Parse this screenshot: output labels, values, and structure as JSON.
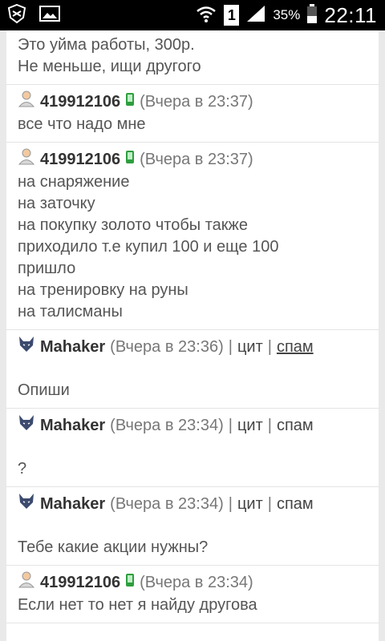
{
  "status_bar": {
    "battery_percent": "35%",
    "clock": "22:11",
    "sim_label": "1",
    "icons": [
      "shield-icon",
      "image-icon",
      "wifi-icon",
      "sim-icon",
      "signal-icon",
      "battery-icon"
    ]
  },
  "messages": [
    {
      "kind": "continuation",
      "lines": [
        "Это уйма работы, 300р.",
        "Не меньше, ищи другого"
      ]
    },
    {
      "author": "419912106",
      "time": "(Вчера в 23:37)",
      "lines": [
        "все что надо мне"
      ]
    },
    {
      "author": "419912106",
      "time": "(Вчера в 23:37)",
      "lines": [
        "на снаряжение",
        "на заточку",
        "на покупку золото чтобы также",
        "приходило т.е купил 100 и еще 100",
        "пришло",
        "на тренировку на руны",
        "на талисманы"
      ]
    },
    {
      "author": "Mahaker",
      "time": "(Вчера в 23:36)",
      "quote_label": "цит",
      "spam_label": "спам",
      "lines": [
        "Опиши"
      ]
    },
    {
      "author": "Mahaker",
      "time": "(Вчера в 23:34)",
      "quote_label": "цит",
      "spam_label": "спам",
      "lines": [
        "?"
      ]
    },
    {
      "author": "Mahaker",
      "time": "(Вчера в 23:34)",
      "quote_label": "цит",
      "spam_label": "спам",
      "lines": [
        "Тебе какие акции нужны?"
      ]
    },
    {
      "author": "419912106",
      "time": "(Вчера в 23:34)",
      "lines": [
        "Если нет то нет я найду другова"
      ]
    }
  ],
  "separator": "|"
}
